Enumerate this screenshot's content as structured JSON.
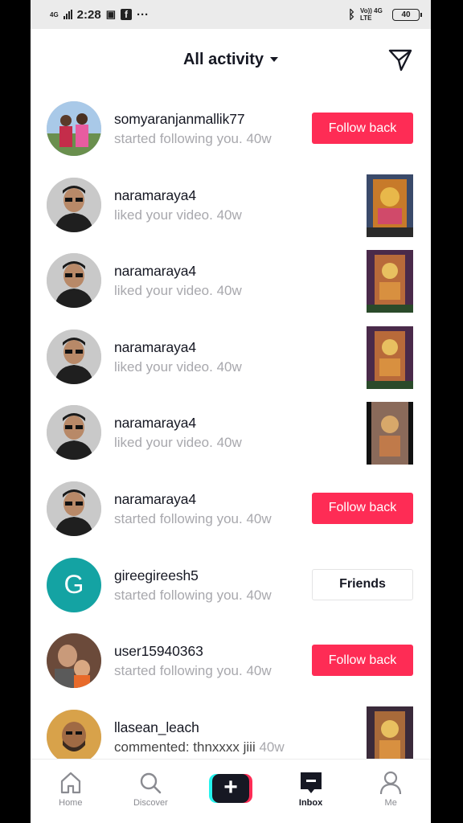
{
  "status_bar": {
    "network": "4G",
    "time": "2:28",
    "more": "···",
    "right_network": "Vo)) 4G LTE",
    "battery": "40"
  },
  "header": {
    "title": "All activity"
  },
  "items": [
    {
      "username": "somyaranjanmallik77",
      "message": "started following you.",
      "time": "40w",
      "action": "Follow back",
      "action_type": "follow",
      "avatar": "photo-two-people"
    },
    {
      "username": "naramaraya4",
      "message": "liked your video.",
      "time": "40w",
      "action_type": "thumb",
      "avatar": "photo-man-sunglasses"
    },
    {
      "username": "naramaraya4",
      "message": "liked your video.",
      "time": "40w",
      "action_type": "thumb",
      "avatar": "photo-man-sunglasses"
    },
    {
      "username": "naramaraya4",
      "message": "liked your video.",
      "time": "40w",
      "action_type": "thumb",
      "avatar": "photo-man-sunglasses"
    },
    {
      "username": "naramaraya4",
      "message": "liked your video.",
      "time": "40w",
      "action_type": "thumb",
      "avatar": "photo-man-sunglasses"
    },
    {
      "username": "naramaraya4",
      "message": "started following you.",
      "time": "40w",
      "action": "Follow back",
      "action_type": "follow",
      "avatar": "photo-man-sunglasses"
    },
    {
      "username": "gireegireesh5",
      "message": "started following you.",
      "time": "40w",
      "action": "Friends",
      "action_type": "friends",
      "avatar_letter": "G"
    },
    {
      "username": "user15940363",
      "message": "started following you.",
      "time": "40w",
      "action": "Follow back",
      "action_type": "follow",
      "avatar": "photo-man-child"
    },
    {
      "username": "llasean_leach",
      "message": "commented: thnxxxx jiii",
      "time": "40w",
      "action_type": "thumb",
      "avatar": "photo-man-beard"
    }
  ],
  "nav": {
    "home": "Home",
    "discover": "Discover",
    "inbox": "Inbox",
    "me": "Me"
  },
  "colors": {
    "accent": "#fe2c55",
    "cyan": "#25f4ee",
    "text": "#161823",
    "muted": "#a8a8ad"
  }
}
